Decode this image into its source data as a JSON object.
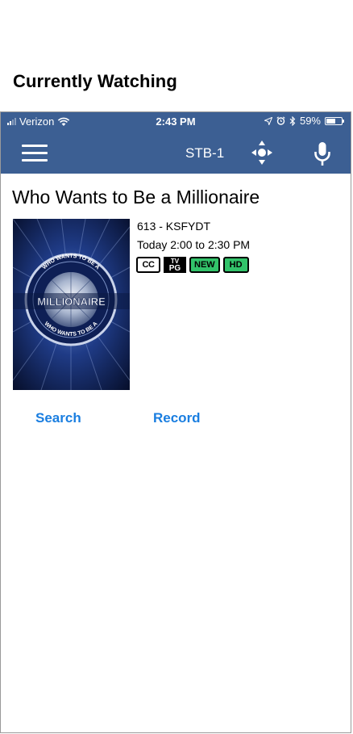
{
  "page_heading": "Currently Watching",
  "status_bar": {
    "carrier": "Verizon",
    "time": "2:43 PM",
    "battery_percent": "59%",
    "battery_level": 0.59
  },
  "nav_bar": {
    "device_label": "STB-1",
    "background_color": "#3c5f93"
  },
  "program": {
    "title": "Who Wants to Be a Millionaire",
    "channel": "613 - KSFYDT",
    "airtime": "Today 2:00 to 2:30 PM",
    "badges": {
      "cc": "CC",
      "rating_top": "TV",
      "rating_bottom": "PG",
      "new": "NEW",
      "hd": "HD"
    },
    "poster": {
      "main_text": "MILLIONAIRE",
      "top_arc": "WHO WANTS TO BE A",
      "bottom_arc": "WHO WANTS TO BE A"
    }
  },
  "actions": {
    "search_label": "Search",
    "record_label": "Record"
  },
  "icons": {
    "menu": "hamburger-menu-icon",
    "dpad": "dpad-icon",
    "mic": "microphone-icon",
    "wifi": "wifi-icon",
    "location": "location-arrow-icon",
    "alarm": "alarm-icon",
    "bluetooth": "bluetooth-icon",
    "battery": "battery-icon"
  },
  "colors": {
    "accent_link": "#1a7ee0",
    "badge_green": "#32c36a"
  }
}
